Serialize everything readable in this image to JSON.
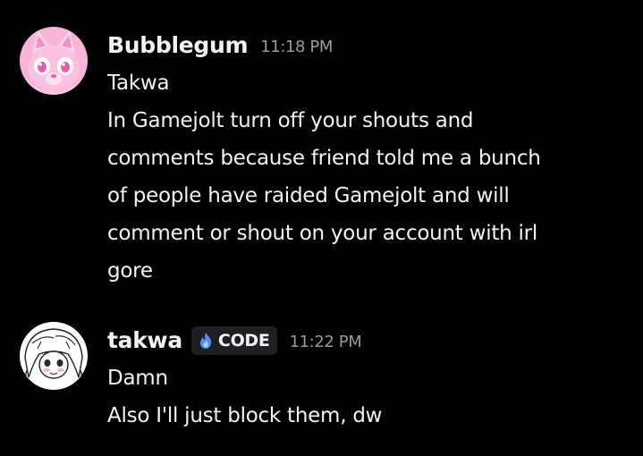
{
  "messages": [
    {
      "author": "Bubblegum",
      "timestamp": "11:18 PM",
      "avatar": "pink-cat-avatar",
      "lines": [
        "Takwa",
        "In Gamejolt turn off your shouts and",
        "comments because friend told me a bunch",
        "of people have raided Gamejolt and will",
        "comment or shout on your account with irl",
        "gore"
      ]
    },
    {
      "author": "takwa",
      "tag": {
        "label": "CODE",
        "icon": "blue-flame-icon"
      },
      "timestamp": "11:22 PM",
      "avatar": "white-haired-character-avatar",
      "lines": [
        "Damn",
        "Also I'll just block them, dw"
      ]
    }
  ],
  "colors": {
    "background": "#000000",
    "text": "#f2f3f5",
    "timestamp": "#949ba4",
    "tag_background": "#1e1f22",
    "tag_icon": "#4e8cff",
    "avatar_pink": "#f7a8d4"
  }
}
